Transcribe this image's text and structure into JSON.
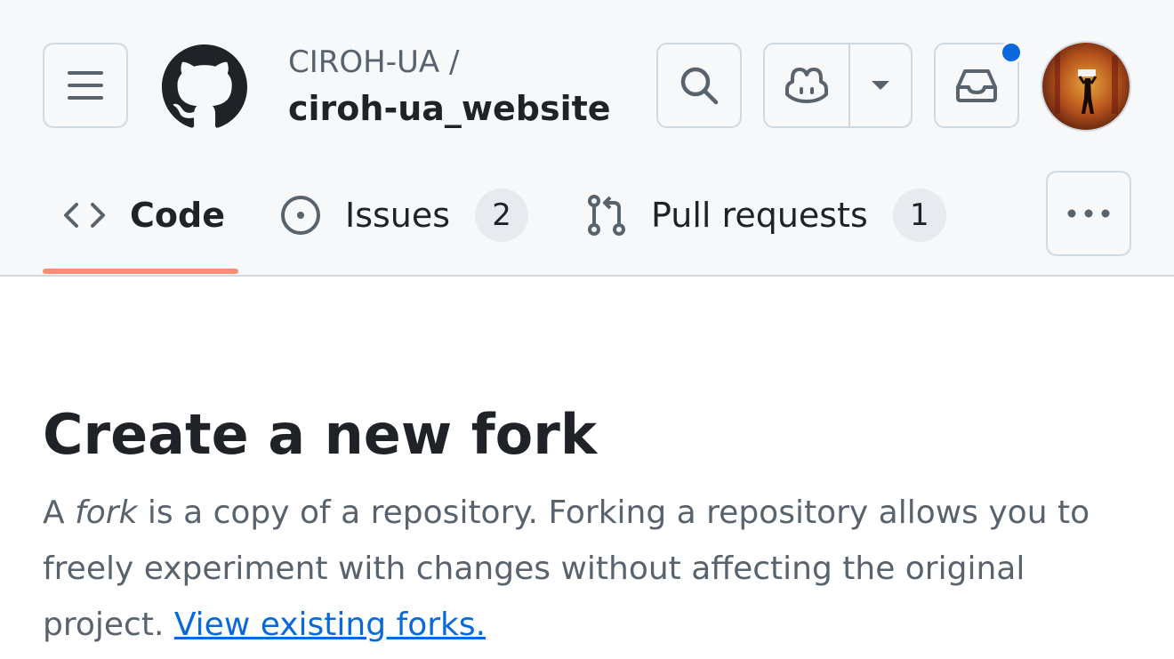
{
  "header": {
    "owner": "CIROH-UA /",
    "repo": "ciroh-ua_website",
    "icons": {
      "menu": "hamburger-icon",
      "logo": "github-mark-icon",
      "search": "search-icon",
      "copilot": "copilot-icon",
      "dropdown": "triangle-down-icon",
      "inbox": "inbox-icon",
      "avatar": "user-avatar"
    },
    "notification_color": "#0969da"
  },
  "tabs": [
    {
      "label": "Code",
      "icon": "code-icon",
      "selected": true
    },
    {
      "label": "Issues",
      "icon": "issue-opened-icon",
      "count": "2"
    },
    {
      "label": "Pull requests",
      "icon": "git-pull-request-icon",
      "count": "1"
    }
  ],
  "more_icon": "kebab-horizontal-icon",
  "main": {
    "title": "Create a new fork",
    "desc_a": "A ",
    "desc_fork": "fork",
    "desc_b": " is a copy of a repository. Forking a repository allows you to freely experiment with changes without affecting the original project. ",
    "desc_link": "View existing forks."
  },
  "colors": {
    "accent_underline": "#fd8c73",
    "link": "#0969da",
    "header_bg": "#f6f8fa"
  }
}
